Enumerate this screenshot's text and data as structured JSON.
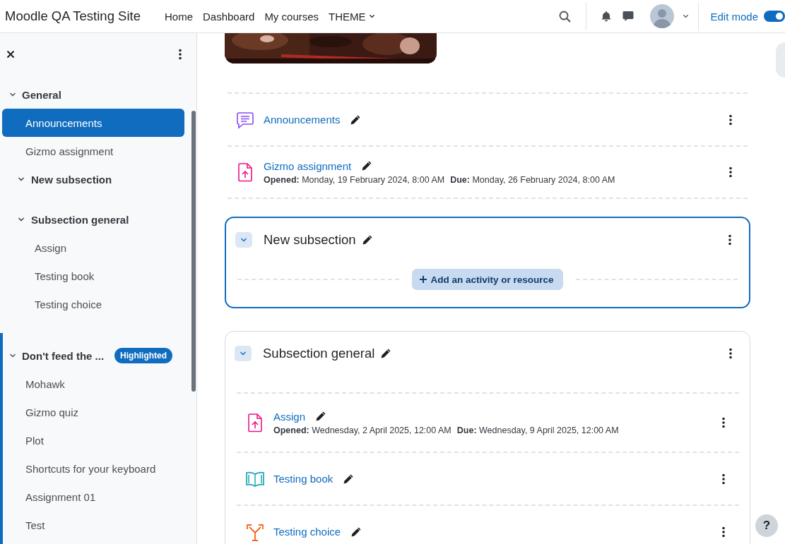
{
  "site_name": "Moodle QA Testing Site",
  "nav": [
    {
      "label": "Home",
      "kind": "link"
    },
    {
      "label": "Dashboard",
      "kind": "link"
    },
    {
      "label": "My courses",
      "kind": "link"
    },
    {
      "label": "THEME",
      "kind": "dropdown"
    }
  ],
  "edit_mode": {
    "label": "Edit mode",
    "on": true
  },
  "course_index": [
    {
      "title": "General",
      "expanded": true,
      "current": false,
      "items": [
        {
          "label": "Announcements",
          "kind": "activity",
          "selected": true
        },
        {
          "label": "Gizmo assignment",
          "kind": "activity",
          "selected": false
        },
        {
          "label": "New subsection",
          "kind": "subsection",
          "expanded": true
        },
        {
          "label": "Subsection general",
          "kind": "subsection",
          "expanded": true,
          "children": [
            {
              "label": "Assign",
              "selected": false
            },
            {
              "label": "Testing book",
              "selected": false
            },
            {
              "label": "Testing choice",
              "selected": false
            }
          ]
        }
      ]
    },
    {
      "title": "Don't feed the ...",
      "expanded": true,
      "current": true,
      "badge": "Highlighted",
      "items": [
        {
          "label": "Mohawk",
          "kind": "activity",
          "selected": false
        },
        {
          "label": "Gizmo quiz",
          "kind": "activity",
          "selected": false
        },
        {
          "label": "Plot",
          "kind": "activity",
          "selected": false
        },
        {
          "label": "Shortcuts for your keyboard",
          "kind": "activity",
          "selected": false
        },
        {
          "label": "Assignment 01",
          "kind": "activity",
          "selected": false
        },
        {
          "label": "Test",
          "kind": "activity",
          "selected": false
        }
      ]
    }
  ],
  "content": {
    "activities": [
      {
        "kind": "forum",
        "name": "Announcements"
      },
      {
        "kind": "assign",
        "name": "Gizmo assignment",
        "dates": [
          {
            "label": "Opened:",
            "value": "Monday, 19 February 2024, 8:00 AM"
          },
          {
            "label": "Due:",
            "value": "Monday, 26 February 2024, 8:00 AM"
          }
        ]
      }
    ],
    "subsections": [
      {
        "title": "New subsection",
        "selected": true,
        "expanded": true,
        "add_button": "Add an activity or resource"
      },
      {
        "title": "Subsection general",
        "selected": false,
        "expanded": true,
        "activities": [
          {
            "kind": "assign",
            "name": "Assign",
            "dates": [
              {
                "label": "Opened:",
                "value": "Wednesday, 2 April 2025, 12:00 AM"
              },
              {
                "label": "Due:",
                "value": "Wednesday, 9 April 2025, 12:00 AM"
              }
            ]
          },
          {
            "kind": "book",
            "name": "Testing book"
          },
          {
            "kind": "choice",
            "name": "Testing choice"
          }
        ]
      }
    ]
  },
  "help_button": "?"
}
